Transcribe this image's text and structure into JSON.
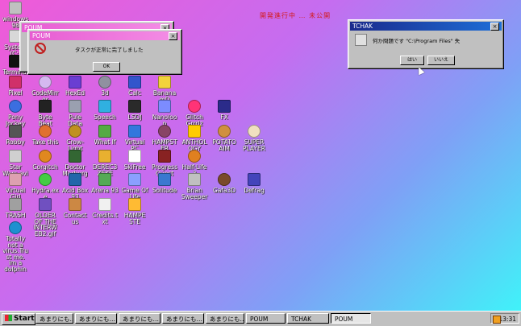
{
  "banner": "開発進行中 … 未公開",
  "icons_col1_top": [
    {
      "label": "windows 98"
    },
    {
      "label": "System (C:)"
    },
    {
      "label": "Terminal"
    }
  ],
  "icons": [
    {
      "label": "Pixel",
      "color": "#d0306a",
      "round": false
    },
    {
      "label": "CodeMirror",
      "color": "#d5b8f0",
      "round": true
    },
    {
      "label": "HexEd",
      "color": "#6a3ed2",
      "round": false
    },
    {
      "label": "3d",
      "color": "#9090a0",
      "round": true
    },
    {
      "label": "Calc",
      "color": "#3355cc",
      "round": false
    },
    {
      "label": "Banana mD",
      "color": "#f2d23b",
      "round": false
    },
    {
      "label": "Pony Jockey",
      "color": "#3b6ee0",
      "round": true
    },
    {
      "label": "Byte Beat",
      "color": "#222222",
      "round": false
    },
    {
      "label": "Pule Data",
      "color": "#9aa0b0",
      "round": false
    },
    {
      "label": "Speech",
      "color": "#30b0e0",
      "round": false
    },
    {
      "label": "LSDJ",
      "color": "#2a2a2a",
      "round": false
    },
    {
      "label": "Nanoloop",
      "color": "#7c8cff",
      "round": false
    },
    {
      "label": "Glitch Grrrlz",
      "color": "#ff3377",
      "round": true
    },
    {
      "label": "FX",
      "color": "#2b2b8a",
      "round": false
    },
    {
      "label": "Robby",
      "color": "#555555",
      "round": false
    },
    {
      "label": "Take this",
      "color": "#e07030",
      "round": true
    },
    {
      "label": "Crow-Light",
      "color": "#c09020",
      "round": true
    },
    {
      "label": "What If",
      "color": "#55aa44",
      "round": false
    },
    {
      "label": "Virtual PC",
      "color": "#3377dd",
      "round": false
    },
    {
      "label": "HAMPSTER",
      "color": "#884466",
      "round": true
    },
    {
      "label": "ANTHOLOGY",
      "color": "#ffcc00",
      "round": false
    },
    {
      "label": "POTATO AIM",
      "color": "#d09040",
      "round": true
    },
    {
      "label": "SUPER PLAYER",
      "color": "#f0e0c0",
      "round": true
    },
    {
      "label": "Star Wars.avi",
      "color": "#d0d0d0",
      "round": false
    },
    {
      "label": "Corgitch",
      "color": "#e08820",
      "round": true
    },
    {
      "label": "Doctor Marburg",
      "color": "#336633",
      "round": false
    },
    {
      "label": "DEREC3ZEKE",
      "color": "#e8b030",
      "round": false
    },
    {
      "label": "SkiFree",
      "color": "#ffffff",
      "round": false
    },
    {
      "label": "Progress Quest",
      "color": "#882222",
      "round": false
    },
    {
      "label": "Half-Life 3",
      "color": "#e08020",
      "round": true
    },
    {
      "label": "Virtual Girl",
      "color": "#dda0b0",
      "round": false
    },
    {
      "label": "Hydra.exe",
      "color": "#44cc44",
      "round": true
    },
    {
      "label": "Acid Box 93",
      "color": "#2266aa",
      "round": false
    },
    {
      "label": "Arena 93",
      "color": "#55aa55",
      "round": false
    },
    {
      "label": "Game Of Life",
      "color": "#8aa0ff",
      "round": false
    },
    {
      "label": "Solitude",
      "color": "#3a78d0",
      "round": false
    },
    {
      "label": "Brian Sweeper",
      "color": "#c0c0c0",
      "round": false
    },
    {
      "label": "Gafa3D",
      "color": "#7a4a2a",
      "round": true
    },
    {
      "label": "Defrag",
      "color": "#4444bb",
      "round": false
    },
    {
      "label": "TRASH",
      "color": "#a0a0a0",
      "round": false
    },
    {
      "label": "OLDER OF THE INTERWEB2.gif",
      "color": "#7050c0",
      "round": false
    },
    {
      "label": "Contact us",
      "color": "#cc8844",
      "round": false
    },
    {
      "label": "Credits.txt",
      "color": "#f0f0f0",
      "round": false
    },
    {
      "label": "HAMPE STE",
      "color": "#ffbb33",
      "round": false
    },
    {
      "label": "Totally not a virus.Trust me. im a dolphin",
      "color": "#1e90d0",
      "round": true
    }
  ],
  "win_back": {
    "title": "POUM"
  },
  "win_front": {
    "title": "POUM",
    "message": "タスクが正常に完了しました",
    "ok_label": "OK"
  },
  "win_tchak": {
    "title": "TCHAK",
    "message": "何か問題です \"C:\\Program Files\" 失",
    "yes_label": "はい",
    "no_label": "いいえ"
  },
  "taskbar": {
    "start_label": "Start",
    "tasks": [
      "あまりにも…",
      "あまりにも…",
      "あまりにも…",
      "あまりにも…",
      "あまりにも…",
      "POUM",
      "TCHAK",
      "POUM"
    ],
    "active_index": 7,
    "clock": "13:31"
  }
}
